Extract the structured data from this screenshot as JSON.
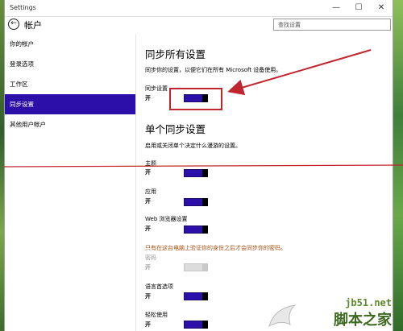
{
  "window": {
    "title": "Settings",
    "min_glyph": "—",
    "max_glyph": "☐",
    "close_glyph": "✕"
  },
  "header": {
    "back_icon": "back-arrow-icon",
    "title": "帐户",
    "search_placeholder": "查找设置"
  },
  "sidebar": {
    "items": [
      {
        "label": "你的帐户",
        "active": false
      },
      {
        "label": "登录选项",
        "active": false
      },
      {
        "label": "工作区",
        "active": false
      },
      {
        "label": "同步设置",
        "active": true
      },
      {
        "label": "其他用户帐户",
        "active": false
      }
    ]
  },
  "sync_all": {
    "heading": "同步所有设置",
    "description": "同步你的设置，以便它们在所有 Microsoft 设备使用。",
    "toggle_label": "同步设置",
    "state": "开"
  },
  "individual": {
    "heading": "单个同步设置",
    "description": "启用或关闭单个决定什么漫游的设置。",
    "items": [
      {
        "label": "主题",
        "state": "开"
      },
      {
        "label": "应用",
        "state": "开"
      },
      {
        "label": "Web 浏览器设置",
        "state": "开"
      }
    ],
    "warning": "只有在这台电脑上验证你的身份之后才会同步你的密码。",
    "password": {
      "label": "密码",
      "state": "开"
    },
    "items_after": [
      {
        "label": "语言首选项",
        "state": "开"
      },
      {
        "label": "轻松使用",
        "state": "开"
      }
    ]
  },
  "watermark": {
    "site": "jb51.net",
    "name": "脚本之家"
  },
  "colors": {
    "accent": "#2b0fa8",
    "annotation": "#c0262e",
    "warning_text": "#b05010"
  }
}
